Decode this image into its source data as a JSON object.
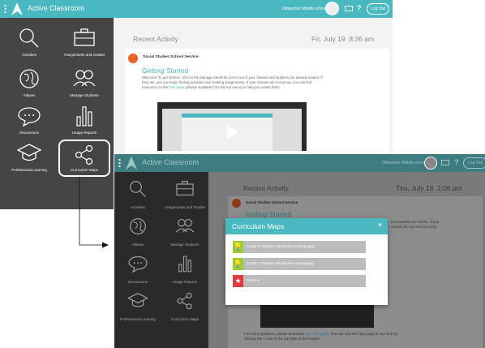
{
  "colors": {
    "teal": "#4ab8c0",
    "sidebar": "#454545",
    "accent_orange": "#e8622a",
    "green_icon": "#9acd32",
    "red_icon": "#e03a3a"
  },
  "app": {
    "title": "Active Classroom",
    "school_back": "Ottwacher Middle school",
    "school_front": "Ottwacher Middle school",
    "help": "?",
    "logout_back": "Log Out",
    "logout_front": "Log Out"
  },
  "sidebar": {
    "items": [
      {
        "label": "Activities",
        "icon": "magnifier-icon"
      },
      {
        "label": "Assignments and Grades",
        "icon": "briefcase-icon"
      },
      {
        "label": "Atlases",
        "icon": "globe-icon"
      },
      {
        "label": "Manage Students",
        "icon": "users-icon"
      },
      {
        "label": "Discussions",
        "icon": "speech-bubble-icon"
      },
      {
        "label": "Usage Reports",
        "icon": "bar-chart-icon"
      },
      {
        "label": "Professional Learning",
        "icon": "graduation-cap-icon"
      },
      {
        "label": "Curriculum Maps",
        "icon": "share-nodes-icon"
      }
    ]
  },
  "activity_back": {
    "heading": "Recent Activity",
    "date": "Fri, July 19",
    "time": "8:36 am",
    "org": "Social Studies School Service",
    "title": "Getting Started",
    "text_1": "Welcome! To get started, click on the Manage Students icon to see if your classes and students are already loaded. If they are, you can begin finding activities and creating assignments. If your classes are not set up, you can find resources on the",
    "link": "help page",
    "text_2": "(always available from the top menu) to help you create them."
  },
  "activity_front": {
    "heading": "Recent Activity",
    "date": "Thu, July 18",
    "time": "2:06 pm",
    "org": "Social Studies School Service",
    "title": "Getting Started",
    "side_text": "and students are clients. If your classes the top menu) to help",
    "footer_1": "For more guidance, please download",
    "footer_link": "our user guide",
    "footer_2": ". You can visit the help page at any time by clicking the ? icon in the top right of the header."
  },
  "modal": {
    "title": "Curriculum Maps",
    "close": "×",
    "items": [
      {
        "label": "Grade 6: Western Hemisphere Geography",
        "icon": "lightbulb-icon",
        "glyph": "💡"
      },
      {
        "label": "Grade 7: Eastern Hemisphere Geography",
        "icon": "lightbulb-icon",
        "glyph": "💡"
      },
      {
        "label": "Grade 8",
        "icon": "star-icon",
        "glyph": "★"
      }
    ]
  }
}
